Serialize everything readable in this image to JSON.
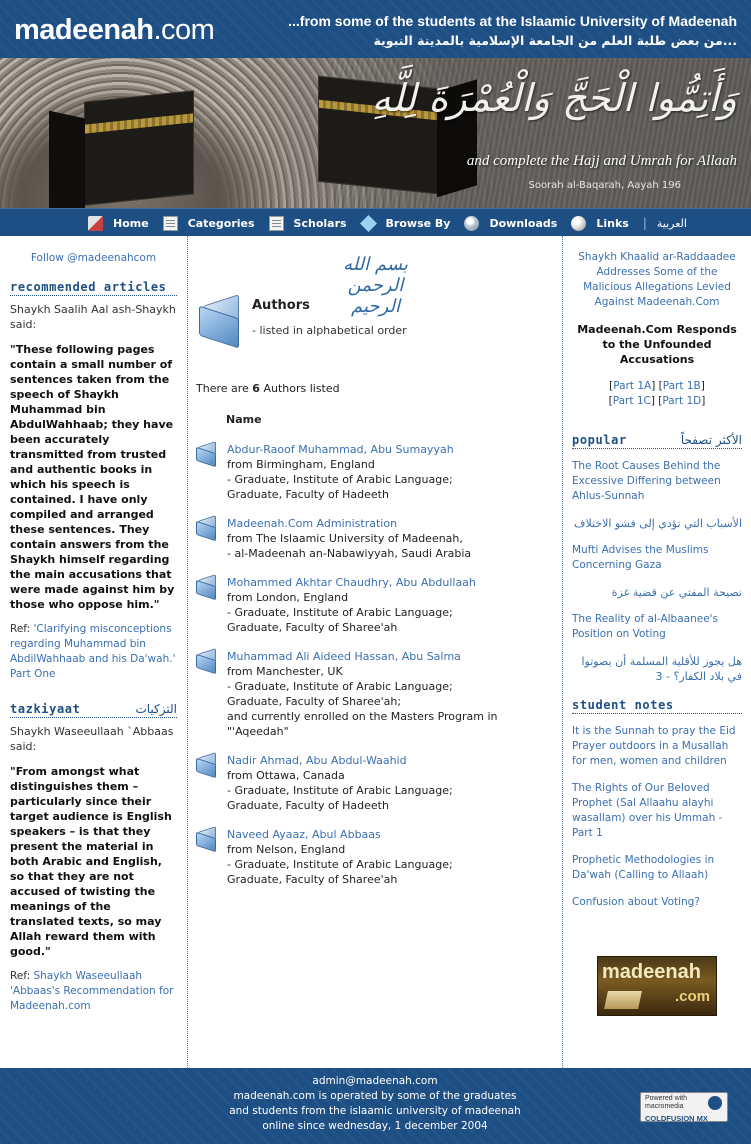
{
  "header": {
    "logo_bold": "madeenah",
    "logo_rest": ".com",
    "tagline_en": "...from some of the students at the Islaamic University of Madeenah",
    "tagline_ar": "...من بعض طلبة العلم من الجامعة الإسلامية بالمدينة النبوية"
  },
  "banner": {
    "verse_ar": "وَأَتِمُّوا الْحَجَّ وَالْعُمْرَةَ لِلَّهِ",
    "verse_en": "and complete the Hajj and Umrah for Allaah",
    "reference": "Soorah al-Baqarah, Aayah 196"
  },
  "nav": {
    "items": [
      {
        "label": "Home",
        "icon": "home-icon"
      },
      {
        "label": "Categories",
        "icon": "document-icon"
      },
      {
        "label": "Scholars",
        "icon": "document-icon"
      },
      {
        "label": "Browse By",
        "icon": "gem-icon"
      },
      {
        "label": "Downloads",
        "icon": "download-icon"
      },
      {
        "label": "Links",
        "icon": "link-icon"
      }
    ],
    "separator": "|",
    "arabic_link": "العربية"
  },
  "left": {
    "follow": "Follow @madeenahcom",
    "recommended": {
      "heading": "recommended articles",
      "attribution": "Shaykh Saalih Aal ash-Shaykh said:",
      "quote": "\"These following pages contain a small number of sentences taken from the speech of Shaykh Muhammad bin AbdulWahhaab; they have been accurately transmitted from trusted and authentic books in which his speech is contained. I have only compiled and arranged these sentences. They contain answers from the Shaykh himself regarding the main accusations that were made against him by those who oppose him.\"",
      "ref_prefix": "Ref: ",
      "ref_link": "'Clarifying misconceptions regarding Muhammad bin AbdilWahhaab and his Da'wah.' Part One"
    },
    "tazkiyaat": {
      "heading_en": "tazkiyaat",
      "heading_ar": "التزكيات",
      "attribution": "Shaykh Waseeullaah `Abbaas said:",
      "quote": "\"From amongst what distinguishes them – particularly since their target audience is English speakers – is that they present the material in both Arabic and English, so that they are not accused of twisting the meanings of the translated texts, so may Allah reward them with good.\"",
      "ref_prefix": "Ref: ",
      "ref_link": "Shaykh Waseeullaah 'Abbaas's Recommendation for Madeenah.com"
    }
  },
  "center": {
    "basmala": "بسم الله الرحمن الرحيم",
    "title": "Authors",
    "subtitle": "- listed in alphabetical order",
    "count_prefix": "There are ",
    "count": "6",
    "count_suffix": " Authors listed",
    "column_header": "Name",
    "authors": [
      {
        "name": "Abdur-Raoof Muhammad, Abu Sumayyah",
        "lines": [
          "from Birmingham, England",
          "- Graduate, Institute of Arabic Language;",
          "Graduate, Faculty of Hadeeth"
        ]
      },
      {
        "name": "Madeenah.Com Administration",
        "lines": [
          "from The Islaamic University of Madeenah,",
          "- al-Madeenah an-Nabawiyyah, Saudi Arabia"
        ]
      },
      {
        "name": "Mohammed Akhtar Chaudhry, Abu Abdullaah",
        "lines": [
          "from London, England",
          "- Graduate, Institute of Arabic Language;",
          "Graduate, Faculty of Sharee'ah"
        ]
      },
      {
        "name": "Muhammad Ali Aideed Hassan, Abu Salma",
        "lines": [
          "from Manchester, UK",
          "- Graduate, Institute of Arabic Language;",
          "Graduate, Faculty of Sharee'ah;",
          "and currently enrolled on the Masters Program in \"'Aqeedah\""
        ]
      },
      {
        "name": "Nadir Ahmad, Abu Abdul-Waahid",
        "lines": [
          "from Ottawa, Canada",
          "- Graduate, Institute of Arabic Language;",
          "Graduate, Faculty of Hadeeth"
        ]
      },
      {
        "name": "Naveed Ayaaz, Abul Abbaas",
        "lines": [
          "from Nelson, England",
          "- Graduate, Institute of Arabic Language;",
          "Graduate, Faculty of Sharee'ah"
        ]
      }
    ]
  },
  "right": {
    "article_link": "Shaykh Khaalid ar-Raddaadee Addresses Some of the Malicious Allegations Levied Against Madeenah.Com",
    "responds_title": "Madeenah.Com Responds to the Unfounded Accusations",
    "parts": [
      "Part 1A",
      "Part 1B",
      "Part 1C",
      "Part 1D"
    ],
    "popular": {
      "heading_en": "popular",
      "heading_ar": "الأكثر تصفحاً",
      "items": [
        {
          "text": "The Root Causes Behind the Excessive Differing between Ahlus-Sunnah",
          "ar": false
        },
        {
          "text": "الأسباب التي تؤدي إلى فشو الاختلاف",
          "ar": true
        },
        {
          "text": "Mufti Advises the Muslims Concerning Gaza",
          "ar": false
        },
        {
          "text": "نصيحة المفتي عن قضية غزة",
          "ar": true
        },
        {
          "text": "The Reality of al-Albaanee's Position on Voting",
          "ar": false
        },
        {
          "text": "هل يجوز للأقلية المسلمة أن يصوتوا في بلاد الكفار؟ - 3",
          "ar": true
        }
      ]
    },
    "student_notes": {
      "heading": "student notes",
      "items": [
        "It is the Sunnah to pray the Eid Prayer outdoors in a Musallah for men, women and children",
        "The Rights of Our Beloved Prophet (Sal Allaahu alayhi wasallam) over his Ummah - Part 1",
        "Prophetic Methodologies in Da'wah (Calling to Allaah)",
        "Confusion about Voting?"
      ]
    },
    "logo_badge": {
      "line1": "madeenah",
      "line2": ".com"
    }
  },
  "footer": {
    "email": "admin@madeenah.com",
    "line1": "madeenah.com is operated by some of the graduates",
    "line2": "and students from the islaamic university of madeenah",
    "line3": "online since wednesday, 1 december 2004",
    "badge_line1": "Powered with",
    "badge_line2": "macromedia",
    "badge_line3": "COLDFUSION MX"
  }
}
